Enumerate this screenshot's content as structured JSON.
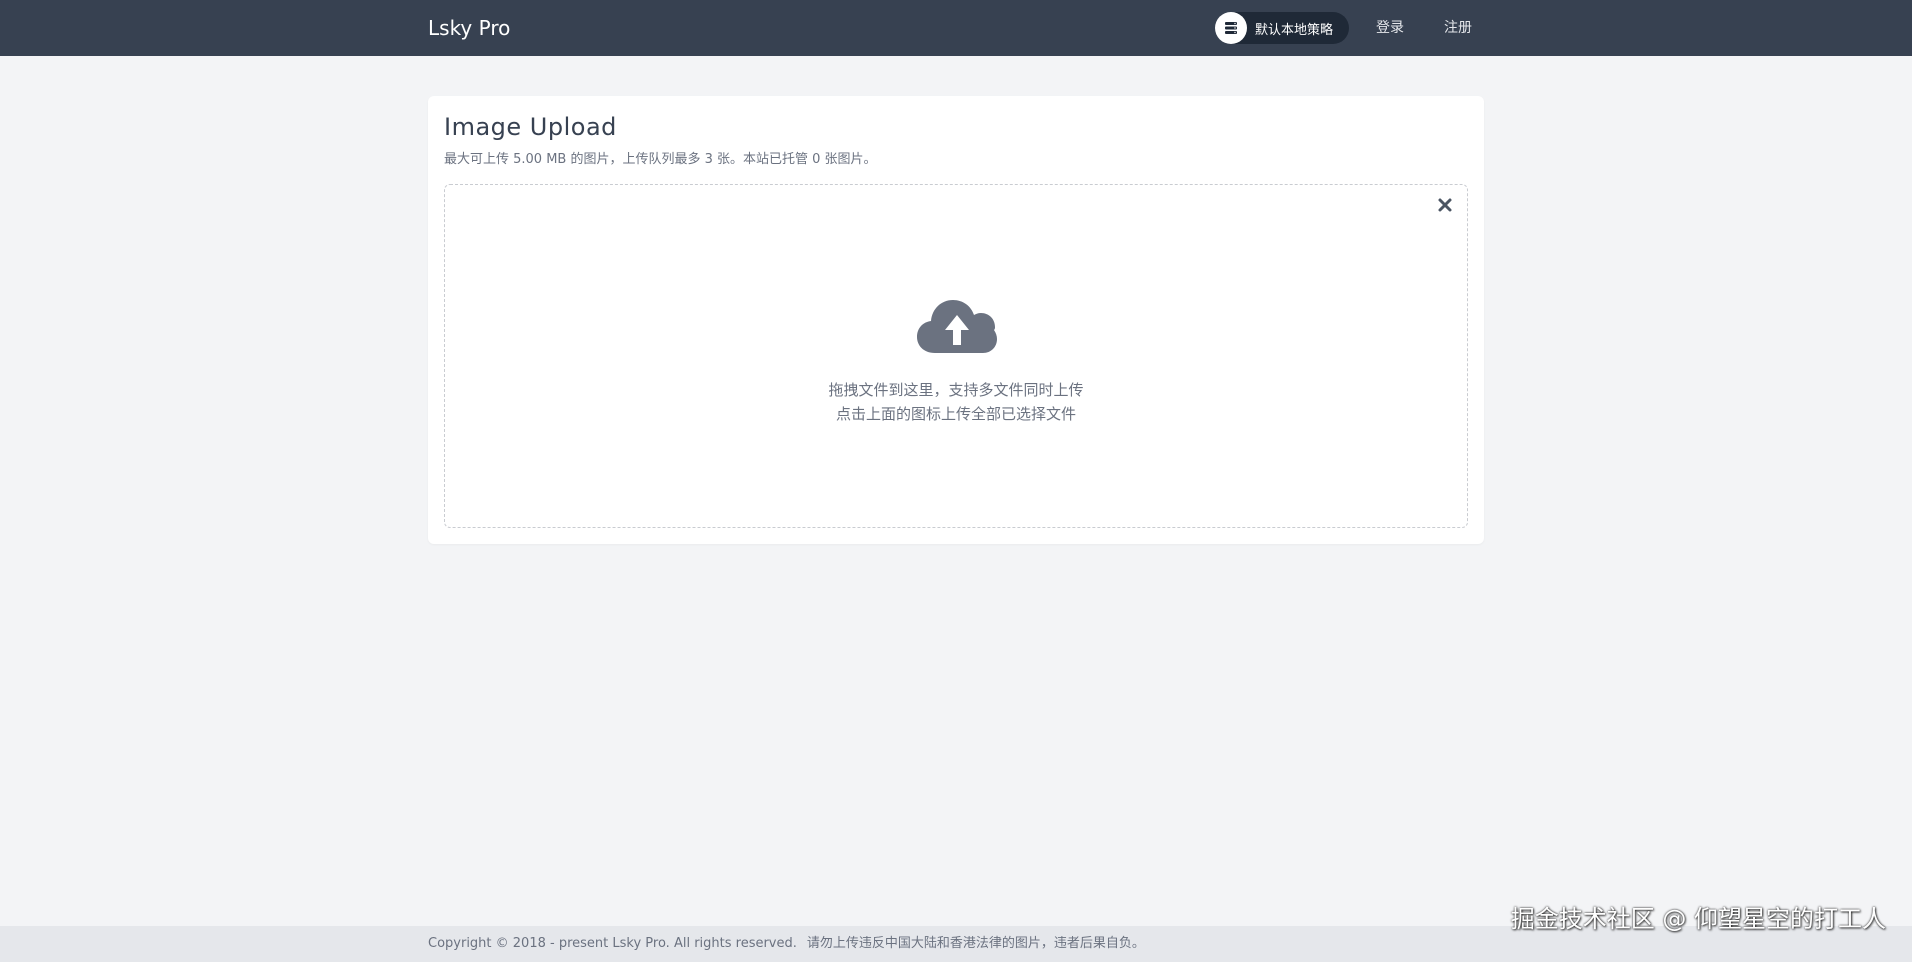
{
  "header": {
    "brand": "Lsky Pro",
    "strategy_label": "默认本地策略",
    "login_label": "登录",
    "register_label": "注册"
  },
  "upload": {
    "title": "Image Upload",
    "subtitle": "最大可上传 5.00 MB 的图片，上传队列最多 3 张。本站已托管 0 张图片。",
    "drop_line1": "拖拽文件到这里，支持多文件同时上传",
    "drop_line2": "点击上面的图标上传全部已选择文件"
  },
  "footer": {
    "copyright": "Copyright © 2018 - present Lsky Pro. All rights reserved.",
    "notice": "请勿上传违反中国大陆和香港法律的图片，违者后果自负。"
  },
  "watermark": "掘金技术社区 @ 仰望星空的打工人",
  "icons": {
    "strategy": "server-icon",
    "close": "close-icon",
    "upload": "cloud-upload-icon"
  },
  "colors": {
    "header_bg": "#374151",
    "pill_bg": "#1f2937",
    "page_bg": "#f3f4f6",
    "icon_gray": "#6b7280"
  }
}
